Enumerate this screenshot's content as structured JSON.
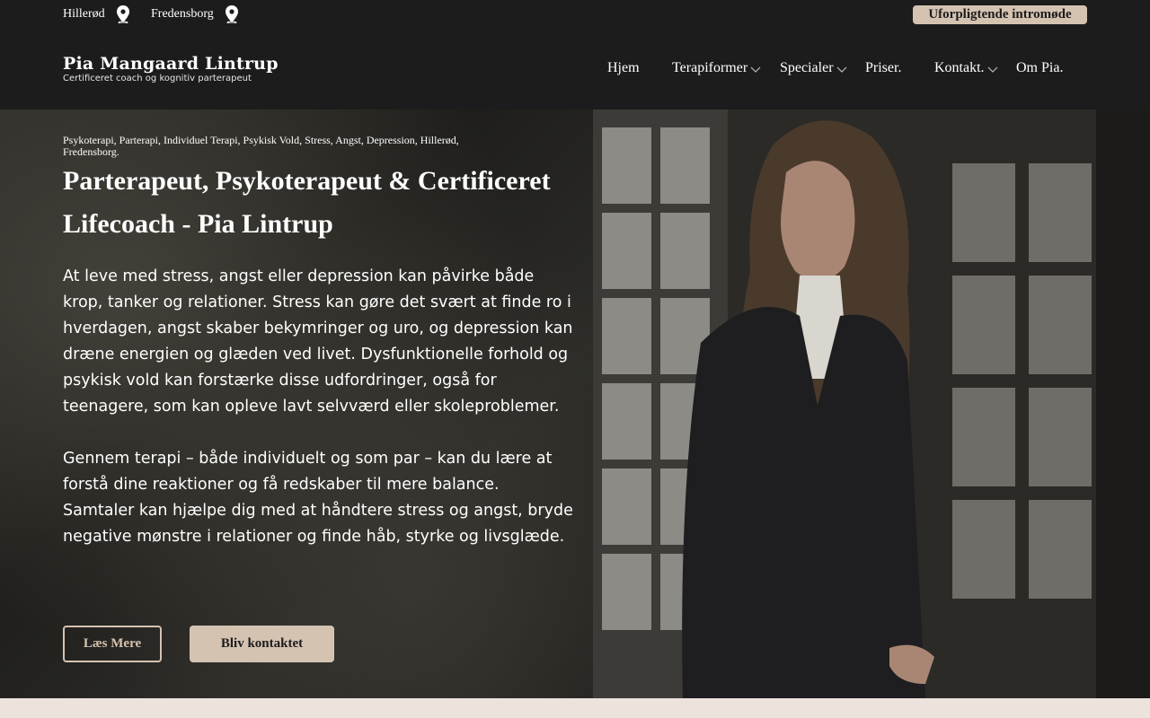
{
  "topbar": {
    "locations": [
      {
        "label": "Hillerød",
        "icon": "map-pin-icon"
      },
      {
        "label": "Fredensborg",
        "icon": "map-pin-icon"
      }
    ],
    "cta_label": "Uforpligtende intromøde"
  },
  "logo": {
    "name": "Pia Mangaard Lintrup",
    "subtitle": "Certificeret coach og kognitiv parterapeut"
  },
  "nav": {
    "items": [
      {
        "label": "Hjem"
      },
      {
        "label": "Terapiformer",
        "icon": "chevron-down-icon"
      },
      {
        "label": "Specialer",
        "icon": "chevron-down-icon"
      },
      {
        "label": "Priser."
      },
      {
        "label": "Kontakt.",
        "icon": "chevron-down-icon"
      },
      {
        "label": "Om Pia."
      }
    ]
  },
  "hero": {
    "tags": "Psykoterapi, Parterapi, Individuel Terapi, Psykisk Vold, Stress, Angst, Depression, Hillerød, Fredensborg.",
    "title": "Parterapeut, Psykoterapeut & Certificeret Lifecoach - Pia Lintrup",
    "paragraphs": [
      "At leve med stress, angst eller depression kan påvirke både krop, tanker og relationer. Stress kan gøre det svært at finde ro i hverdagen, angst skaber bekymringer og uro, og depression kan dræne energien og glæden ved livet. Dysfunktionelle forhold og psykisk vold kan forstærke disse udfordringer, også for teenagere, som kan opleve lavt selvværd eller skoleproblemer.",
      "Gennem terapi – både individuelt og som par – kan du lære at forstå dine reaktioner og få redskaber til mere balance. Samtaler kan hjælpe dig med at håndtere stress og angst, bryde negative mønstre i relationer og finde håb, styrke og livsglæde."
    ],
    "buttons": {
      "more": "Læs Mere",
      "contact": "Bliv kontaktet"
    }
  },
  "colors": {
    "dark": "#1c1c1c",
    "accent": "#d5c3b1",
    "page_bg": "#ece3dd"
  }
}
